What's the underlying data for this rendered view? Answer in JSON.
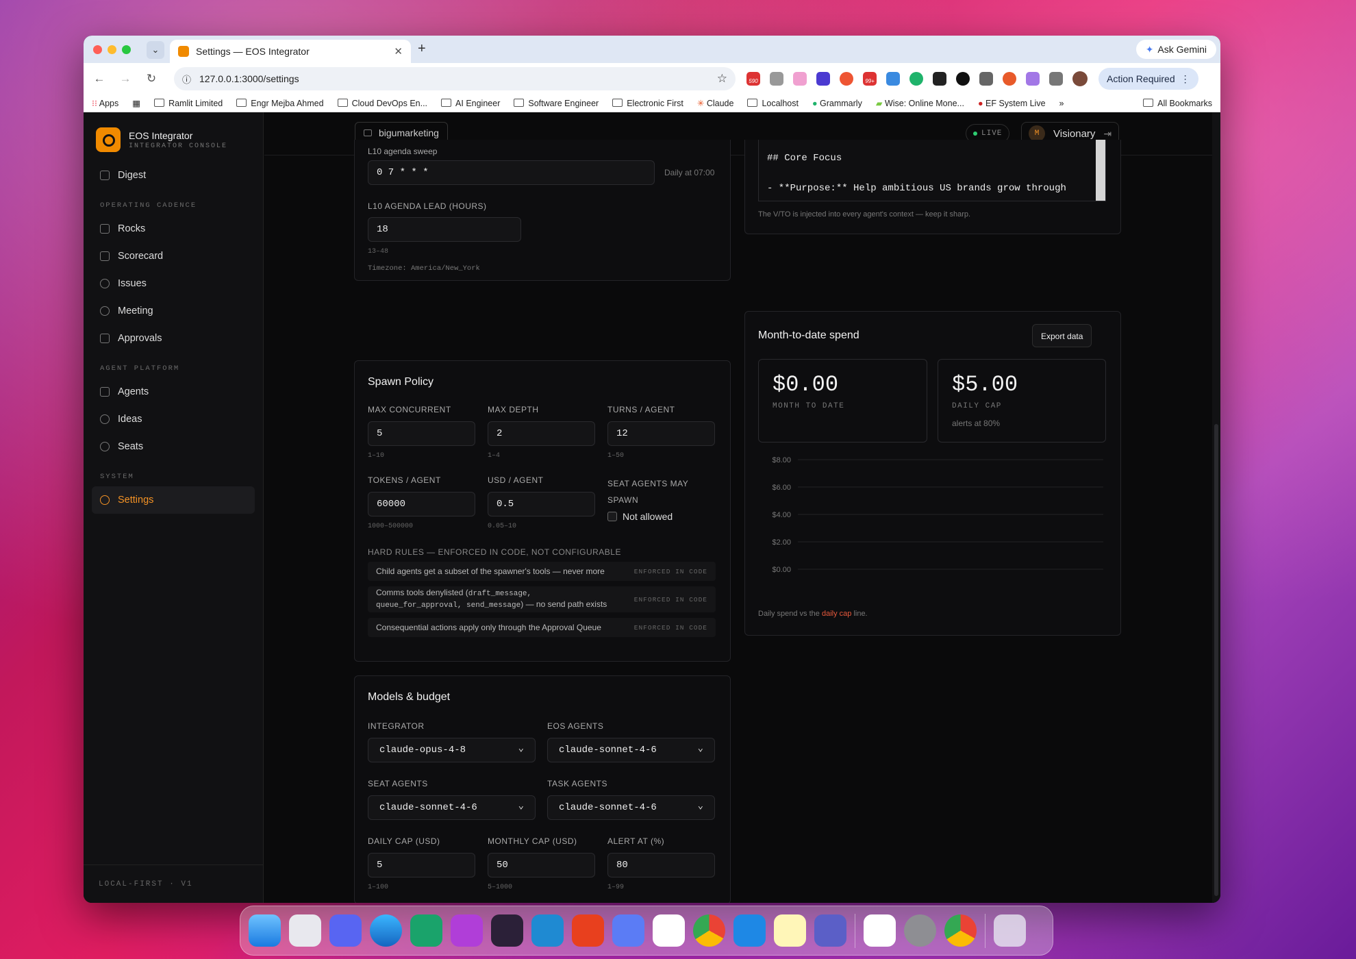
{
  "browser": {
    "tab_title": "Settings — EOS Integrator",
    "url": "127.0.0.1:3000/settings",
    "ask_gemini": "Ask Gemini",
    "action_required": "Action Required",
    "bookmarks": [
      "Apps",
      "Ramlit Limited",
      "Engr Mejba Ahmed",
      "Cloud DevOps En...",
      "AI Engineer",
      "Software Engineer",
      "Electronic First",
      "Claude",
      "Localhost",
      "Grammarly",
      "Wise: Online Mone...",
      "EF System Live"
    ],
    "all_bookmarks": "All Bookmarks",
    "badge_1": "590",
    "badge_2": "99+"
  },
  "sidebar": {
    "app_name": "EOS Integrator",
    "app_sub": "INTEGRATOR CONSOLE",
    "digest": "Digest",
    "section_cadence": "OPERATING CADENCE",
    "cadence_items": [
      "Rocks",
      "Scorecard",
      "Issues",
      "Meeting",
      "Approvals"
    ],
    "section_platform": "AGENT PLATFORM",
    "platform_items": [
      "Agents",
      "Ideas",
      "Seats"
    ],
    "section_system": "SYSTEM",
    "settings": "Settings",
    "footer": "LOCAL-FIRST · V1"
  },
  "topbar": {
    "workspace": "bigumarketing",
    "live": "LIVE",
    "avatar_initial": "M",
    "role": "Visionary"
  },
  "cadence_card": {
    "sweep_label": "L10 agenda sweep",
    "sweep_value": "0 7 * * *",
    "sweep_hint": "Daily at 07:00",
    "lead_label": "L10 AGENDA LEAD (HOURS)",
    "lead_value": "18",
    "lead_range": "13–48",
    "timezone": "Timezone: America/New_York"
  },
  "spawn": {
    "title": "Spawn Policy",
    "max_concurrent_label": "MAX CONCURRENT",
    "max_concurrent": "5",
    "max_concurrent_range": "1–10",
    "max_depth_label": "MAX DEPTH",
    "max_depth": "2",
    "max_depth_range": "1–4",
    "turns_label": "TURNS / AGENT",
    "turns": "12",
    "turns_range": "1–50",
    "tokens_label": "TOKENS / AGENT",
    "tokens": "60000",
    "tokens_range": "1000–500000",
    "usd_label": "USD / AGENT",
    "usd": "0.5",
    "usd_range": "0.05–10",
    "seat_spawn_label_1": "SEAT AGENTS MAY",
    "seat_spawn_label_2": "SPAWN",
    "seat_spawn_value": "Not allowed",
    "rules_header": "HARD RULES — ENFORCED IN CODE, NOT CONFIGURABLE",
    "rule_1": "Child agents get a subset of the spawner's tools — never more",
    "rule_2a": "Comms tools denylisted (",
    "rule_2_code1": "draft_message,",
    "rule_2_code2": "queue_for_approval, send_message",
    "rule_2b": ") — no send path exists",
    "rule_3": "Consequential actions apply only through the Approval Queue",
    "enforced": "ENFORCED IN CODE"
  },
  "models": {
    "title": "Models & budget",
    "integrator_label": "INTEGRATOR",
    "integrator": "claude-opus-4-8",
    "eos_label": "EOS AGENTS",
    "eos": "claude-sonnet-4-6",
    "seat_label": "SEAT AGENTS",
    "seat": "claude-sonnet-4-6",
    "task_label": "TASK AGENTS",
    "task": "claude-sonnet-4-6",
    "daily_label": "DAILY CAP (USD)",
    "daily": "5",
    "daily_range": "1–100",
    "monthly_label": "MONTHLY CAP (USD)",
    "monthly": "50",
    "monthly_range": "5–1000",
    "alert_label": "ALERT AT (%)",
    "alert": "80",
    "alert_range": "1–99"
  },
  "vto": {
    "line1": "## Core Focus",
    "line2": "- **Purpose:** Help ambitious US brands grow through",
    "note": "The V/TO is injected into every agent's context — keep it sharp."
  },
  "spend": {
    "title": "Month-to-date spend",
    "export": "Export data",
    "mtd_value": "$0.00",
    "mtd_label": "MONTH TO DATE",
    "cap_value": "$5.00",
    "cap_label": "DAILY CAP",
    "cap_note": "alerts at 80%",
    "caption_a": "Daily spend vs the",
    "caption_link": "daily cap",
    "caption_b": "line."
  },
  "chart_data": {
    "type": "line",
    "title": "",
    "xlabel": "",
    "ylabel": "",
    "ylim": [
      0,
      8
    ],
    "yticks": [
      "$8.00",
      "$6.00",
      "$4.00",
      "$2.00",
      "$0.00"
    ],
    "grid": true,
    "series": []
  },
  "colors": {
    "accent": "#f39225",
    "live": "#2ecc71",
    "link": "#e8593c"
  }
}
